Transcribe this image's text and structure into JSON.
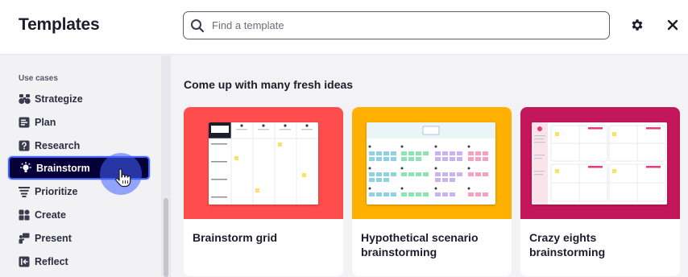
{
  "header": {
    "title": "Templates",
    "search_placeholder": "Find a template",
    "settings_icon": "gear-icon",
    "close_icon": "close-icon"
  },
  "sidebar": {
    "section_label": "Use cases",
    "items": [
      {
        "label": "Strategize",
        "icon": "binoculars-icon",
        "active": false
      },
      {
        "label": "Plan",
        "icon": "list-icon",
        "active": false
      },
      {
        "label": "Research",
        "icon": "question-icon",
        "active": false
      },
      {
        "label": "Brainstorm",
        "icon": "lightbulb-icon",
        "active": true
      },
      {
        "label": "Prioritize",
        "icon": "priority-bars-icon",
        "active": false
      },
      {
        "label": "Create",
        "icon": "shapes-icon",
        "active": false
      },
      {
        "label": "Present",
        "icon": "presenter-icon",
        "active": false
      },
      {
        "label": "Reflect",
        "icon": "reflect-icon",
        "active": false
      }
    ]
  },
  "main": {
    "heading": "Come up with many fresh ideas",
    "cards": [
      {
        "label": "Brainstorm grid",
        "color": "#ff4d4d"
      },
      {
        "label": "Hypothetical scenario brainstorming",
        "color": "#ffb000"
      },
      {
        "label": "Crazy eights brainstorming",
        "color": "#c2185b"
      }
    ]
  },
  "colors": {
    "active_bg": "#050038",
    "accent": "#4262ff"
  }
}
